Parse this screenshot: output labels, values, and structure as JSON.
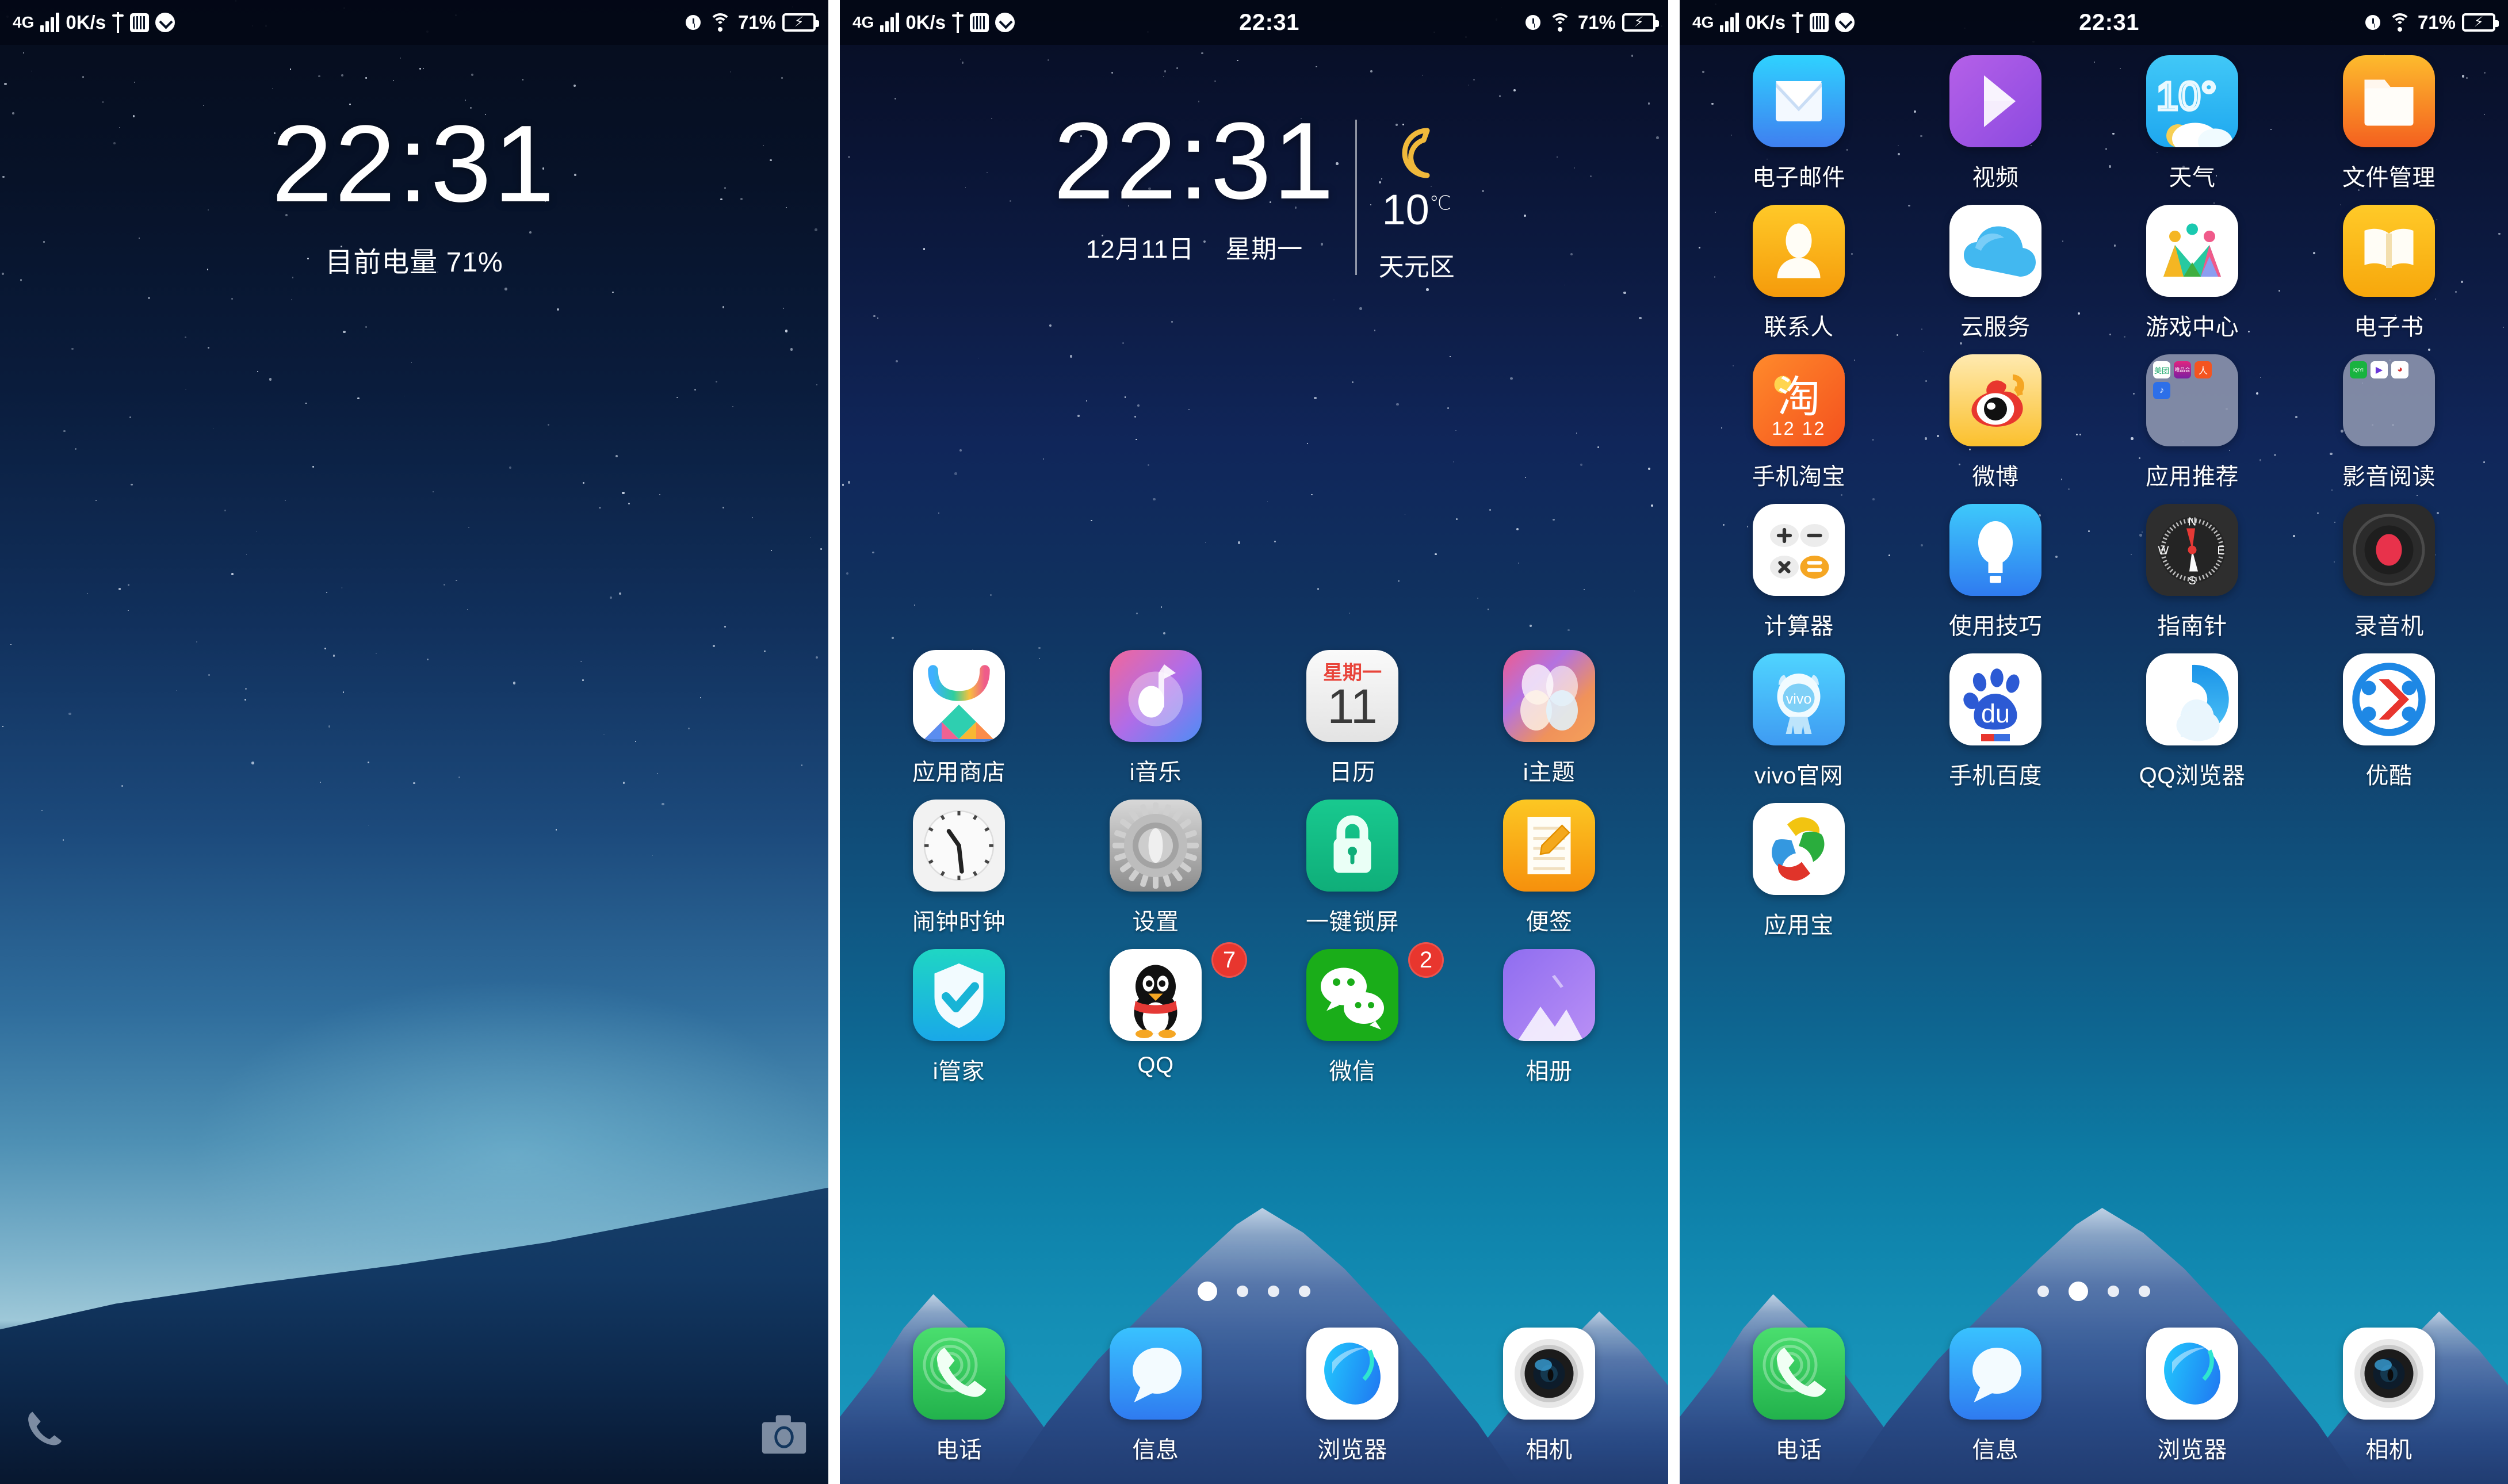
{
  "statusbar": {
    "network": "4G",
    "speed": "0K/s",
    "time": "22:31",
    "battery_pct": "71%",
    "icons": [
      "signal-bars-icon",
      "usb-icon",
      "usb-debug-icon",
      "vpn-check-icon",
      "alarm-icon",
      "wifi-icon",
      "battery-charging-icon"
    ]
  },
  "lockscreen": {
    "time": "22:31",
    "battery_text": "目前电量 71%",
    "phone_shortcut": "phone-icon",
    "camera_shortcut": "camera-icon"
  },
  "widget": {
    "time": "22:31",
    "date": "12月11日",
    "weekday": "星期一",
    "temperature": "10",
    "temp_unit": "℃",
    "city": "天元区",
    "weather_icon": "moon-icon"
  },
  "home_page_1": {
    "apps": [
      {
        "label": "应用商店",
        "icon": "app-store-icon"
      },
      {
        "label": "i音乐",
        "icon": "music-icon"
      },
      {
        "label": "日历",
        "icon": "calendar-icon",
        "cal_weekday": "星期一",
        "cal_day": "11"
      },
      {
        "label": "i主题",
        "icon": "theme-icon"
      },
      {
        "label": "闹钟时钟",
        "icon": "clock-icon"
      },
      {
        "label": "设置",
        "icon": "settings-gear-icon"
      },
      {
        "label": "一键锁屏",
        "icon": "lock-icon"
      },
      {
        "label": "便签",
        "icon": "notes-icon"
      },
      {
        "label": "i管家",
        "icon": "shield-check-icon"
      },
      {
        "label": "QQ",
        "icon": "qq-penguin-icon",
        "badge": "7"
      },
      {
        "label": "微信",
        "icon": "wechat-icon",
        "badge": "2"
      },
      {
        "label": "相册",
        "icon": "gallery-icon"
      }
    ],
    "dots": {
      "count": 4,
      "active": 0
    }
  },
  "home_page_2": {
    "apps": [
      {
        "label": "电子邮件",
        "icon": "email-icon"
      },
      {
        "label": "视频",
        "icon": "video-play-icon"
      },
      {
        "label": "天气",
        "icon": "weather-icon",
        "temp": "10°"
      },
      {
        "label": "文件管理",
        "icon": "folder-icon"
      },
      {
        "label": "联系人",
        "icon": "contacts-icon"
      },
      {
        "label": "云服务",
        "icon": "cloud-icon"
      },
      {
        "label": "游戏中心",
        "icon": "game-center-icon"
      },
      {
        "label": "电子书",
        "icon": "ebook-icon"
      },
      {
        "label": "手机淘宝",
        "icon": "taobao-icon",
        "icon_text": "淘",
        "sub_text": "12 12"
      },
      {
        "label": "微博",
        "icon": "weibo-icon"
      },
      {
        "label": "应用推荐",
        "icon": "folder-group-icon"
      },
      {
        "label": "影音阅读",
        "icon": "folder-group-icon"
      },
      {
        "label": "计算器",
        "icon": "calculator-icon"
      },
      {
        "label": "使用技巧",
        "icon": "tips-bulb-icon"
      },
      {
        "label": "指南针",
        "icon": "compass-icon"
      },
      {
        "label": "录音机",
        "icon": "recorder-icon"
      },
      {
        "label": "vivo官网",
        "icon": "vivo-icon",
        "icon_text": "vivo"
      },
      {
        "label": "手机百度",
        "icon": "baidu-icon",
        "icon_text": "du"
      },
      {
        "label": "QQ浏览器",
        "icon": "qq-browser-icon"
      },
      {
        "label": "优酷",
        "icon": "youku-icon"
      },
      {
        "label": "应用宝",
        "icon": "yingyongbao-icon"
      }
    ],
    "dots": {
      "count": 4,
      "active": 1
    }
  },
  "dock": {
    "apps": [
      {
        "label": "电话",
        "icon": "phone-icon"
      },
      {
        "label": "信息",
        "icon": "message-icon"
      },
      {
        "label": "浏览器",
        "icon": "browser-icon"
      },
      {
        "label": "相机",
        "icon": "camera-icon"
      }
    ]
  },
  "colors": {
    "badge_red": "#e8362e",
    "accent_blue": "#1b9ac0",
    "wechat_green": "#1aad19",
    "phone_green": "#34c759",
    "notes_orange": "#f5a623"
  }
}
